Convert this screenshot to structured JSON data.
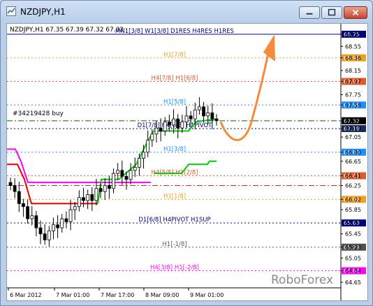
{
  "window": {
    "title": "NZDJPY,H1"
  },
  "chart_header": {
    "symbol_info": "NZDJPY,H1  67.35 67.39 67.32 67.32"
  },
  "watermark": "RoboForex",
  "order_label": "#34219428 buy",
  "colors": {
    "background": "#ffffff",
    "candles": "#000000",
    "green_line": "#00cc00",
    "magenta_line": "#ff00ff",
    "red_line": "#e00000",
    "arrow": "#f58a3a"
  },
  "chart_data": {
    "type": "candlestick",
    "symbol": "NZDJPY",
    "timeframe": "H1",
    "ohlc": {
      "open": 67.35,
      "high": 67.39,
      "low": 67.32,
      "close": 67.32
    },
    "ylim": [
      64.65,
      68.75
    ],
    "ticks_y": [
      "68.75",
      "68.55",
      "68.36",
      "68.15",
      "67.97",
      "67.75",
      "67.58",
      "67.32",
      "67.19",
      "67.05",
      "66.80",
      "66.65",
      "66.41",
      "66.25",
      "66.02",
      "65.85",
      "65.63",
      "65.45",
      "65.23",
      "65.05",
      "64.84",
      "64.65"
    ],
    "xticks": [
      "6 Mar 2012",
      "7 Mar 01:00",
      "7 Mar 17:00",
      "8 Mar 09:00",
      "9 Mar 01:00"
    ],
    "levels": [
      {
        "price": 68.75,
        "label": "MN1[3/8] W1[3/8] D1RES H4RES H1RES",
        "color": "#000080",
        "tag_bg": "#000080",
        "tag_fg": "#ffffff",
        "style": "solid"
      },
      {
        "price": 68.36,
        "label": "H1[7/8]",
        "color": "#f0a020",
        "tag_bg": "#f0a020",
        "tag_fg": "#ffffff",
        "style": "dotted"
      },
      {
        "price": 67.97,
        "label": "H4[7/8] H1[6/8]",
        "color": "#e05a2a",
        "tag_bg": "#e05a2a",
        "tag_fg": "#ffffff",
        "style": "dotted"
      },
      {
        "price": 67.58,
        "label": "H1[5/8]",
        "color": "#1e90ff",
        "tag_bg": "#1e90ff",
        "tag_fg": "#ffffff",
        "style": "dotted"
      },
      {
        "price": 67.32,
        "label": "",
        "color": "#000000",
        "tag_bg": "#000000",
        "tag_fg": "#ffffff",
        "style": "none"
      },
      {
        "price": 67.19,
        "label": "D1[7/8] H4[6/8] H1PIVOT",
        "color": "#000080",
        "tag_bg": "#1a2a5c",
        "tag_fg": "#ffffff",
        "style": "dotted"
      },
      {
        "price": 66.8,
        "label": "H1[3/8]",
        "color": "#1e90ff",
        "tag_bg": "#1e90ff",
        "tag_fg": "#ffffff",
        "style": "dotted"
      },
      {
        "price": 66.41,
        "label": "H4[5/8] H1[2/8]",
        "color": "#e05a2a",
        "tag_bg": "#e05a2a",
        "tag_fg": "#ffffff",
        "style": "dotted"
      },
      {
        "price": 66.02,
        "label": "H1[1/8]",
        "color": "#f0a020",
        "tag_bg": "#f0a020",
        "tag_fg": "#ffffff",
        "style": "dotted"
      },
      {
        "price": 65.63,
        "label": "D1[6/8] H4PIVOT H1SUP",
        "color": "#000080",
        "tag_bg": "#000080",
        "tag_fg": "#ffffff",
        "style": "dotted"
      },
      {
        "price": 65.23,
        "label": "H1[-1/8]",
        "color": "#606060",
        "tag_bg": "#505050",
        "tag_fg": "#ffffff",
        "style": "dotted"
      },
      {
        "price": 64.84,
        "label": "H4[3/8] H1[-2/8]",
        "color": "#ff00ff",
        "tag_bg": "#ff00ff",
        "tag_fg": "#ffffff",
        "style": "dotted"
      }
    ],
    "extra_lines": [
      {
        "price": 67.32,
        "color": "#006600",
        "style": "dashdot"
      },
      {
        "price": 66.25,
        "color": "#c03030",
        "style": "dashdot"
      }
    ],
    "candles_close": [
      66.25,
      66.15,
      65.95,
      65.9,
      65.7,
      65.75,
      65.55,
      65.45,
      65.35,
      65.5,
      65.6,
      65.55,
      65.7,
      65.65,
      65.85,
      65.9,
      66.05,
      66.0,
      66.1,
      66.0,
      66.2,
      66.15,
      66.25,
      66.2,
      66.45,
      66.5,
      66.4,
      66.35,
      66.5,
      66.55,
      66.7,
      66.8,
      67.0,
      67.1,
      67.2,
      67.15,
      67.3,
      67.25,
      67.35,
      67.2,
      67.3,
      67.4,
      67.35,
      67.5,
      67.55,
      67.4,
      67.45,
      67.35,
      67.32
    ]
  }
}
